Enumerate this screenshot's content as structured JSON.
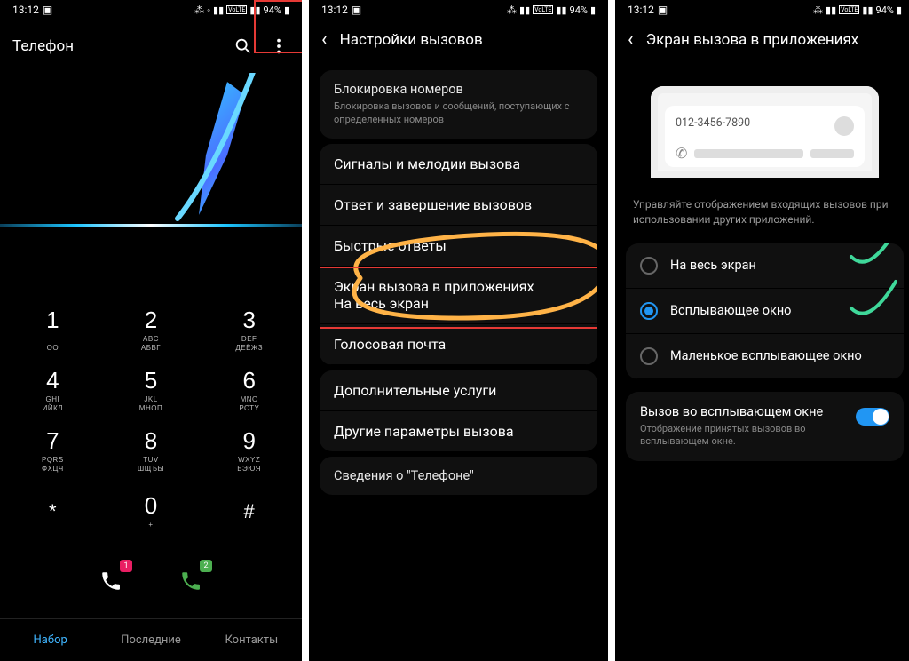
{
  "status": {
    "time": "13:12",
    "battery": "94%"
  },
  "panel1": {
    "title": "Телефон",
    "keys": [
      {
        "n": "1",
        "s1": "",
        "s2": "ОО"
      },
      {
        "n": "2",
        "s1": "ABC",
        "s2": "АБВГ"
      },
      {
        "n": "3",
        "s1": "DEF",
        "s2": "ДЕЁЖЗ"
      },
      {
        "n": "4",
        "s1": "GHI",
        "s2": "ИЙКЛ"
      },
      {
        "n": "5",
        "s1": "JKL",
        "s2": "МНОП"
      },
      {
        "n": "6",
        "s1": "MNO",
        "s2": "РСТУ"
      },
      {
        "n": "7",
        "s1": "PQRS",
        "s2": "ФХЦЧ"
      },
      {
        "n": "8",
        "s1": "TUV",
        "s2": "ШЩЪЫ"
      },
      {
        "n": "9",
        "s1": "WXYZ",
        "s2": "ЬЭЮЯ"
      },
      {
        "n": "*",
        "s1": "",
        "s2": ""
      },
      {
        "n": "0",
        "s1": "+",
        "s2": ""
      },
      {
        "n": "#",
        "s1": "",
        "s2": ""
      }
    ],
    "sim1_badge": "1",
    "sim2_badge": "2",
    "tabs": {
      "dial": "Набор",
      "recent": "Последние",
      "contacts": "Контакты"
    }
  },
  "panel2": {
    "header": "Настройки вызовов",
    "items": {
      "block_t": "Блокировка номеров",
      "block_d": "Блокировка вызовов и сообщений, поступающих с определенных номеров",
      "ringtones": "Сигналы и мелодии вызова",
      "answer_end": "Ответ и завершение вызовов",
      "quick": "Быстрые ответы",
      "calldisp_t": "Экран вызова в приложениях",
      "calldisp_s": "На весь экран",
      "voicemail": "Голосовая почта",
      "supp": "Дополнительные услуги",
      "other": "Другие параметры вызова",
      "about": "Сведения о \"Телефоне\""
    }
  },
  "panel3": {
    "header": "Экран вызова в приложениях",
    "preview_number": "012-3456-7890",
    "desc": "Управляйте отображением входящих вызовов при использовании других приложений.",
    "opts": {
      "full": "На весь экран",
      "popup": "Всплывающее окно",
      "mini": "Маленькое всплывающее окно"
    },
    "toggle_t": "Вызов во всплывающем окне",
    "toggle_d": "Отображение принятых вызовов во всплывающем окне."
  }
}
